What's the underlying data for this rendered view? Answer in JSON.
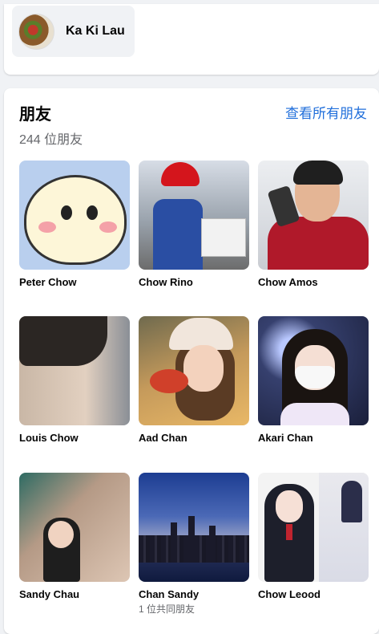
{
  "profile": {
    "name": "Ka Ki Lau"
  },
  "friends_section": {
    "title": "朋友",
    "count_text": "244 位朋友",
    "see_all_label": "查看所有朋友"
  },
  "friends": [
    {
      "name": "Peter Chow",
      "mutual": ""
    },
    {
      "name": "Chow Rino",
      "mutual": ""
    },
    {
      "name": "Chow Amos",
      "mutual": ""
    },
    {
      "name": "Louis Chow",
      "mutual": ""
    },
    {
      "name": "Aad Chan",
      "mutual": ""
    },
    {
      "name": "Akari Chan",
      "mutual": ""
    },
    {
      "name": "Sandy Chau",
      "mutual": ""
    },
    {
      "name": "Chan Sandy",
      "mutual": "1 位共同朋友"
    },
    {
      "name": "Chow Leood",
      "mutual": ""
    }
  ],
  "colors": {
    "link": "#216fdb",
    "page_background": "#f0f2f5",
    "secondary_text": "#65676b"
  }
}
